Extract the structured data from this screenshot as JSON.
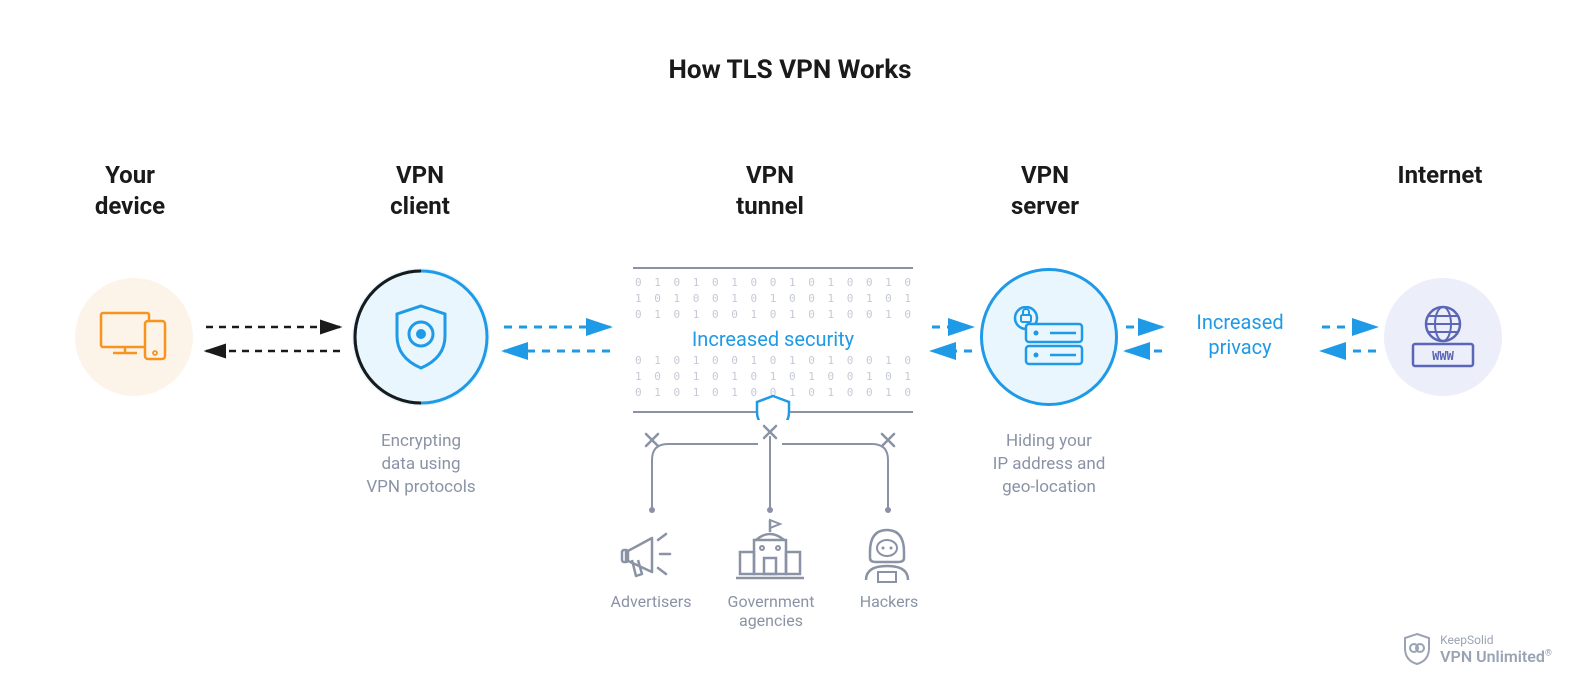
{
  "title": "How TLS VPN Works",
  "columns": {
    "device": "Your\ndevice",
    "client": "VPN\nclient",
    "tunnel": "VPN\ntunnel",
    "server": "VPN\nserver",
    "internet": "Internet"
  },
  "captions": {
    "client": "Encrypting\ndata using\nVPN protocols",
    "server": "Hiding your\nIP address and\ngeo-location"
  },
  "links": {
    "tunnel": "Increased security",
    "privacy": "Increased\nprivacy"
  },
  "threats": {
    "advertisers": "Advertisers",
    "government": "Government\nagencies",
    "hackers": "Hackers"
  },
  "brand": {
    "line1": "KeepSolid",
    "line2": "VPN Unlimited"
  },
  "colors": {
    "orange": "#f7931e",
    "blue": "#1f9ae7",
    "gray": "#8a93a6",
    "indigo": "#5b66b8"
  }
}
